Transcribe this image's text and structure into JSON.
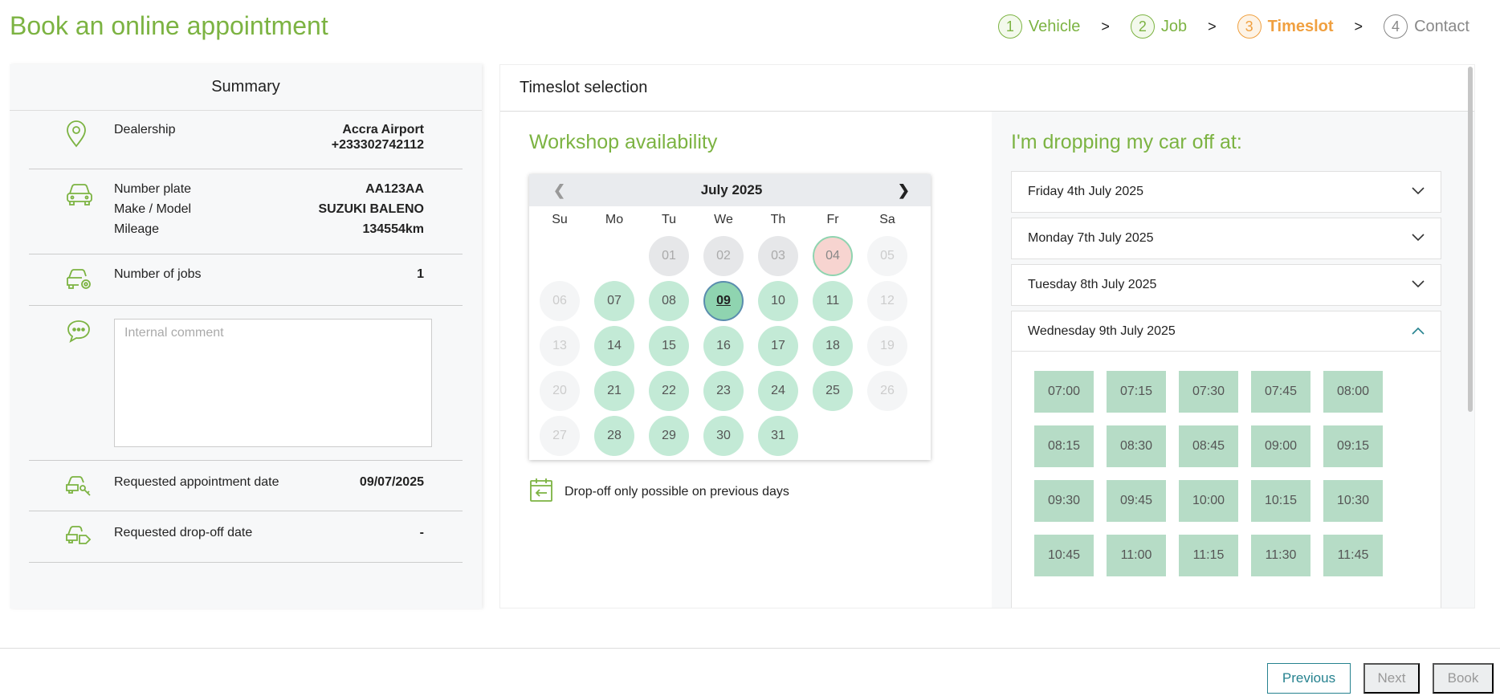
{
  "page": {
    "title": "Book an online appointment"
  },
  "steps": [
    {
      "num": "1",
      "label": "Vehicle",
      "state": "done"
    },
    {
      "num": "2",
      "label": "Job",
      "state": "done"
    },
    {
      "num": "3",
      "label": "Timeslot",
      "state": "active"
    },
    {
      "num": "4",
      "label": "Contact",
      "state": "todo"
    }
  ],
  "step_separator": ">",
  "summary": {
    "title": "Summary",
    "dealership": {
      "label": "Dealership",
      "name": "Accra Airport",
      "phone": "+233302742112"
    },
    "vehicle": {
      "plate_label": "Number plate",
      "plate": "AA123AA",
      "model_label": "Make / Model",
      "model": "SUZUKI BALENO",
      "mileage_label": "Mileage",
      "mileage": "134554km"
    },
    "jobs": {
      "label": "Number of jobs",
      "value": "1"
    },
    "comment": {
      "placeholder": "Internal comment",
      "value": ""
    },
    "appointment": {
      "label": "Requested appointment date",
      "value": "09/07/2025"
    },
    "dropoff": {
      "label": "Requested drop-off date",
      "value": "-"
    }
  },
  "timeslot": {
    "title": "Timeslot selection",
    "availability_title": "Workshop availability",
    "dropoff_title": "I'm dropping my car off at:",
    "dropoff_note": "Drop-off only possible on previous days"
  },
  "calendar": {
    "month": "July 2025",
    "prev_icon": "❮",
    "next_icon": "❯",
    "weekdays": [
      "Su",
      "Mo",
      "Tu",
      "We",
      "Th",
      "Fr",
      "Sa"
    ],
    "weeks": [
      [
        {
          "d": "",
          "s": "empty"
        },
        {
          "d": "",
          "s": "empty"
        },
        {
          "d": "01",
          "s": "closed"
        },
        {
          "d": "02",
          "s": "closed"
        },
        {
          "d": "03",
          "s": "closed"
        },
        {
          "d": "04",
          "s": "full"
        },
        {
          "d": "05",
          "s": "disabled"
        }
      ],
      [
        {
          "d": "06",
          "s": "disabled"
        },
        {
          "d": "07",
          "s": "avail"
        },
        {
          "d": "08",
          "s": "avail"
        },
        {
          "d": "09",
          "s": "selected"
        },
        {
          "d": "10",
          "s": "avail"
        },
        {
          "d": "11",
          "s": "avail"
        },
        {
          "d": "12",
          "s": "disabled"
        }
      ],
      [
        {
          "d": "13",
          "s": "disabled"
        },
        {
          "d": "14",
          "s": "avail"
        },
        {
          "d": "15",
          "s": "avail"
        },
        {
          "d": "16",
          "s": "avail"
        },
        {
          "d": "17",
          "s": "avail"
        },
        {
          "d": "18",
          "s": "avail"
        },
        {
          "d": "19",
          "s": "disabled"
        }
      ],
      [
        {
          "d": "20",
          "s": "disabled"
        },
        {
          "d": "21",
          "s": "avail"
        },
        {
          "d": "22",
          "s": "avail"
        },
        {
          "d": "23",
          "s": "avail"
        },
        {
          "d": "24",
          "s": "avail"
        },
        {
          "d": "25",
          "s": "avail"
        },
        {
          "d": "26",
          "s": "disabled"
        }
      ],
      [
        {
          "d": "27",
          "s": "disabled"
        },
        {
          "d": "28",
          "s": "avail"
        },
        {
          "d": "29",
          "s": "avail"
        },
        {
          "d": "30",
          "s": "avail"
        },
        {
          "d": "31",
          "s": "avail"
        },
        {
          "d": "",
          "s": "empty"
        },
        {
          "d": "",
          "s": "empty"
        }
      ]
    ]
  },
  "dropoff_days": [
    {
      "label": "Friday 4th July 2025",
      "expanded": false
    },
    {
      "label": "Monday 7th July 2025",
      "expanded": false
    },
    {
      "label": "Tuesday 8th July 2025",
      "expanded": false
    },
    {
      "label": "Wednesday 9th July 2025",
      "expanded": true
    }
  ],
  "time_slots": [
    "07:00",
    "07:15",
    "07:30",
    "07:45",
    "08:00",
    "08:15",
    "08:30",
    "08:45",
    "09:00",
    "09:15",
    "09:30",
    "09:45",
    "10:00",
    "10:15",
    "10:30",
    "10:45",
    "11:00",
    "11:15",
    "11:30",
    "11:45"
  ],
  "footer": {
    "previous": "Previous",
    "next": "Next",
    "book": "Book"
  },
  "colors": {
    "brand_green": "#7cb342",
    "active_orange": "#f0a040",
    "teal": "#26828f",
    "slot_green": "#b6dcc6"
  }
}
